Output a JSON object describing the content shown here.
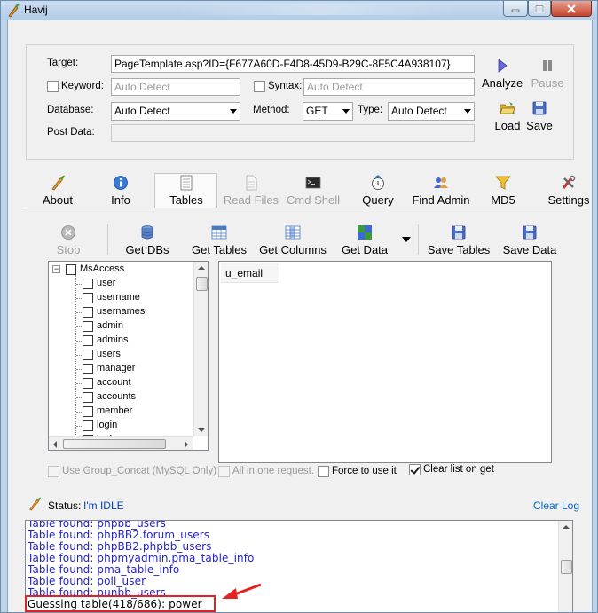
{
  "window": {
    "title": "Havij",
    "controls": [
      "minimize-icon",
      "maximize-icon",
      "close-icon"
    ]
  },
  "form": {
    "target_label": "Target:",
    "target_value": "PageTemplate.asp?ID={F677A60D-F4D8-45D9-B29C-8F5C4A938107}",
    "keyword_label": "Keyword:",
    "keyword_placeholder": "Auto Detect",
    "keyword_checked": false,
    "syntax_label": "Syntax:",
    "syntax_placeholder": "Auto Detect",
    "syntax_checked": false,
    "database_label": "Database:",
    "database_value": "Auto Detect",
    "method_label": "Method:",
    "method_value": "GET",
    "type_label": "Type:",
    "type_value": "Auto Detect",
    "postdata_label": "Post Data:",
    "postdata_value": ""
  },
  "actions": {
    "analyze": "Analyze",
    "pause": "Pause",
    "load": "Load",
    "save": "Save"
  },
  "tabs": [
    {
      "label": "About",
      "icon": "quill-icon",
      "enabled": true
    },
    {
      "label": "Info",
      "icon": "info-icon",
      "enabled": true
    },
    {
      "label": "Tables",
      "icon": "table-doc-icon",
      "enabled": true,
      "selected": true
    },
    {
      "label": "Read Files",
      "icon": "file-icon",
      "enabled": false
    },
    {
      "label": "Cmd Shell",
      "icon": "terminal-icon",
      "enabled": false
    },
    {
      "label": "Query",
      "icon": "query-icon",
      "enabled": true
    },
    {
      "label": "Find Admin",
      "icon": "users-icon",
      "enabled": true
    },
    {
      "label": "MD5",
      "icon": "funnel-icon",
      "enabled": true
    },
    {
      "label": "Settings",
      "icon": "tools-icon",
      "enabled": true
    }
  ],
  "toolbar": {
    "stop": "Stop",
    "get_dbs": "Get DBs",
    "get_tables": "Get Tables",
    "get_columns": "Get Columns",
    "get_data": "Get Data",
    "save_tables": "Save Tables",
    "save_data": "Save Data"
  },
  "tree": {
    "root": "MsAccess",
    "items": [
      "user",
      "username",
      "usernames",
      "admin",
      "admins",
      "users",
      "manager",
      "account",
      "accounts",
      "member",
      "login",
      "logins"
    ]
  },
  "columns": {
    "header": "u_email"
  },
  "options": {
    "group_concat": "Use Group_Concat (MySQL Only)",
    "all_in_one": "All in one request.",
    "force": "Force to use it",
    "clear_list": "Clear list on get",
    "clear_list_checked": true
  },
  "status": {
    "label": "Status:",
    "value": "I'm IDLE",
    "clear_log": "Clear Log"
  },
  "log": {
    "partial_top": "Table found: phpbb_users",
    "lines": [
      "Table found: phpBB2.forum_users",
      "Table found: phpBB2.phpbb_users",
      "Table found: phpmyadmin.pma_table_info",
      "Table found: pma_table_info",
      "Table found: poll_user",
      "Table found: punbb_users"
    ],
    "highlighted": "Guessing table(418/686): power"
  },
  "colors": {
    "log_text": "#2222cc",
    "highlight_border": "#e32222",
    "window_frame": "#bcd3ea"
  }
}
